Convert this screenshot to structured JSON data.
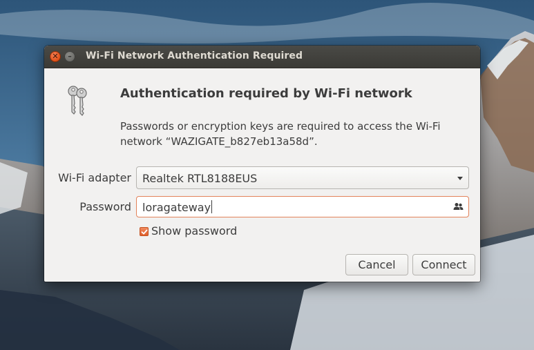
{
  "dialog": {
    "title": "Wi-Fi Network Authentication Required",
    "controls": {
      "close_icon": "close-icon",
      "minimize_icon": "minimize-icon"
    },
    "icon": "keys-icon",
    "heading": "Authentication required by Wi-Fi network",
    "description": "Passwords or encryption keys are required to access the Wi-Fi network “WAZIGATE_b827eb13a58d”.",
    "adapter": {
      "label": "Wi-Fi adapter",
      "selected": "Realtek RTL8188EUS"
    },
    "password": {
      "label": "Password",
      "value": "loragateway",
      "icon": "users-icon"
    },
    "show_password": {
      "label": "Show password",
      "checked": true
    },
    "buttons": {
      "cancel": "Cancel",
      "connect": "Connect"
    }
  },
  "colors": {
    "accent": "#e05f2c",
    "titlebar": "#3b3a36",
    "dialog_bg": "#f2f1f0",
    "text": "#3c3c3c"
  }
}
